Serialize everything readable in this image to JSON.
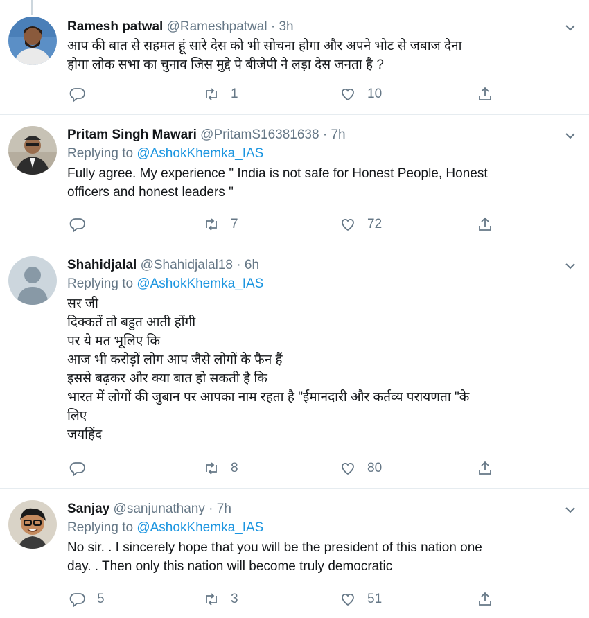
{
  "tweets": [
    {
      "name": "Ramesh patwal",
      "handle": "@Rameshpatwal",
      "dot": "·",
      "time": "3h",
      "text": "आप की बात से सहमत हूं सारे देस को भी सोचना होगा  और अपने भोट से जबाज देना\nहोगा  लोक सभा का चुनाव जिस मुद्दे पे बीजेपी ने लड़ा देस जनता है ?",
      "replies": "",
      "retweets": "1",
      "likes": "10"
    },
    {
      "name": "Pritam Singh Mawari",
      "handle": "@PritamS16381638",
      "dot": "·",
      "time": "7h",
      "replying_prefix": "Replying to ",
      "replying_to": "@AshokKhemka_IAS",
      "text": "Fully agree. My experience \" India is not safe for Honest People, Honest\nofficers and honest leaders \"",
      "replies": "",
      "retweets": "7",
      "likes": "72"
    },
    {
      "name": "Shahidjalal",
      "handle": "@Shahidjalal18",
      "dot": "·",
      "time": "6h",
      "replying_prefix": "Replying to ",
      "replying_to": "@AshokKhemka_IAS",
      "text": "सर जी\nदिक्कतें तो बहुत आती होंगी\nपर ये मत भूलिए कि\nआज भी करोड़ों लोग आप जैसे लोगों के फैन हैं\nइससे बढ़कर और क्या बात हो सकती है कि\nभारत में लोगों की जुबान पर आपका नाम रहता है \"ईमानदारी और कर्तव्य परायणता \"के\nलिए\nजयहिंद",
      "replies": "",
      "retweets": "8",
      "likes": "80"
    },
    {
      "name": "Sanjay",
      "handle": "@sanjunathany",
      "dot": "·",
      "time": "7h",
      "replying_prefix": "Replying to ",
      "replying_to": "@AshokKhemka_IAS",
      "text": "No sir. .  I sincerely hope that you will be the president of this nation one\nday. . Then only this nation will become truly democratic",
      "replies": "5",
      "retweets": "3",
      "likes": "51"
    }
  ],
  "colors": {
    "accent": "#1b95e0",
    "muted": "#657786",
    "divider": "#e6ecf0"
  },
  "icons": [
    "reply-icon",
    "retweet-icon",
    "like-icon",
    "share-icon",
    "chevron-down-icon"
  ]
}
